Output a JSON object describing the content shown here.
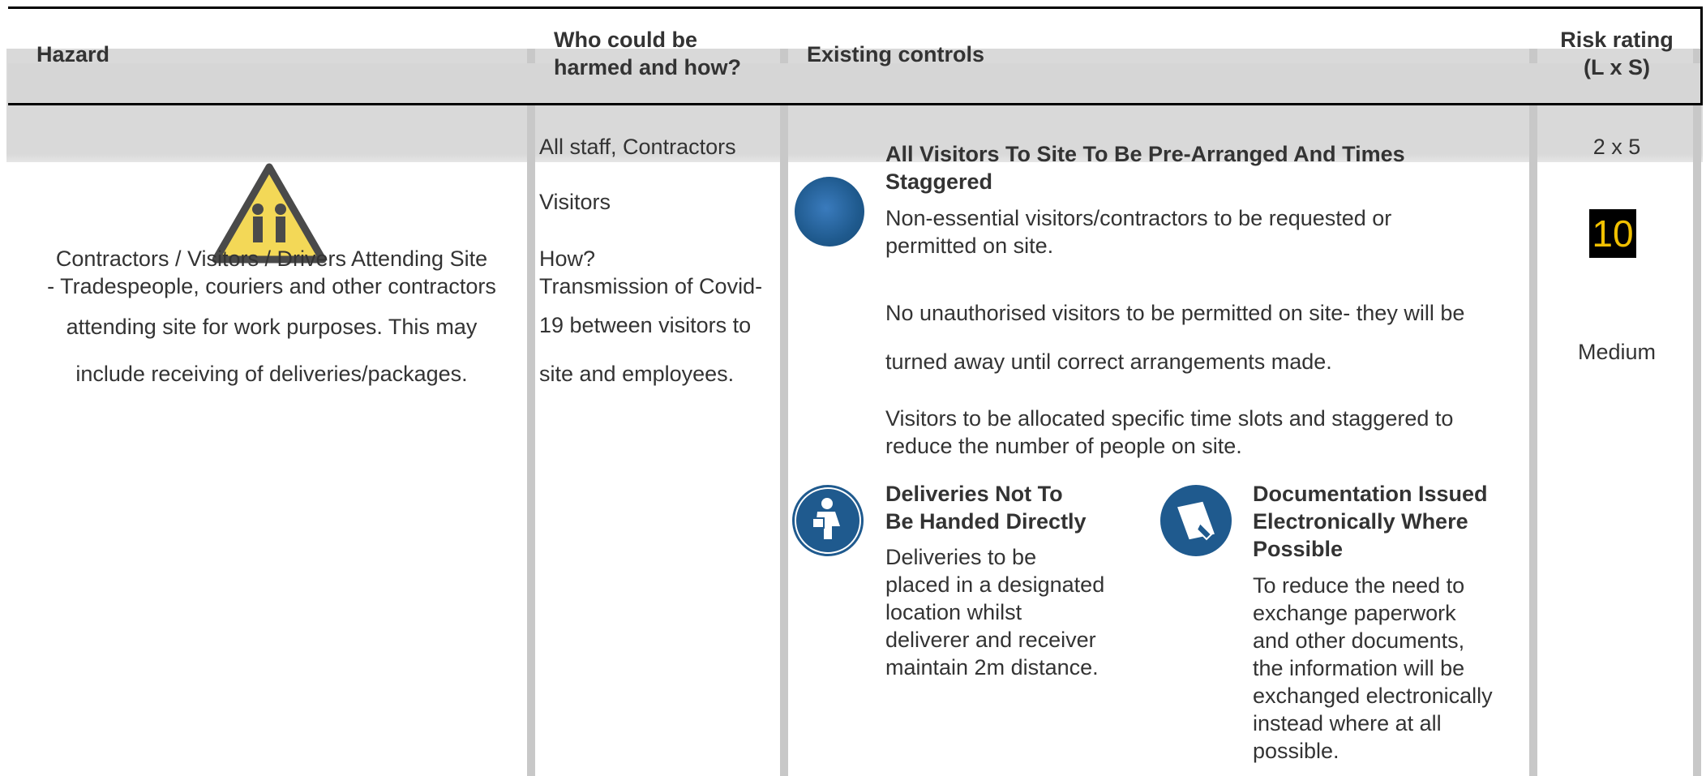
{
  "headers": {
    "hazard": "Hazard",
    "who": [
      "Who could be",
      "harmed and how?"
    ],
    "controls": "Existing controls",
    "risk": [
      "Risk rating",
      "(L x S)"
    ]
  },
  "hazard": {
    "lines": [
      "Contractors / Visitors / Drivers Attending Site",
      "- Tradespeople, couriers and other contractors",
      "attending site for work purposes. This may",
      "include receiving of deliveries/packages."
    ],
    "icon": "warning-triangle-icon"
  },
  "who": {
    "line1": "All staff, Contractors",
    "line2": "Visitors",
    "line3": "How?",
    "line4": "Transmission of Covid-",
    "line5": "19 between visitors to",
    "line6": "site and employees."
  },
  "controls": {
    "prearranged": {
      "icon": "globe-icon",
      "title": [
        "All Visitors To Site To Be Pre-Arranged And Times",
        "Staggered"
      ],
      "body": [
        "Non-essential visitors/contractors to be requested or",
        "permitted on site."
      ]
    },
    "unauthorised": [
      "No unauthorised visitors to be permitted on site- they will be",
      "turned away until correct arrangements made."
    ],
    "staggered": [
      "Visitors to be allocated specific time slots and staggered to",
      "reduce the number of people on site."
    ],
    "deliveries": {
      "icon": "delivery-person-icon",
      "title": [
        "Deliveries Not To",
        "Be Handed Directly"
      ],
      "body": [
        "Deliveries to be",
        "placed in a designated",
        "location whilst",
        "deliverer and receiver",
        "maintain 2m distance."
      ]
    },
    "documentation": {
      "icon": "document-icon",
      "title": [
        "Documentation Issued",
        "Electronically Where",
        "Possible"
      ],
      "body": [
        "To reduce the need to",
        "exchange paperwork",
        "and other documents,",
        "the information will be",
        "exchanged electronically",
        "instead where at all",
        "possible."
      ]
    }
  },
  "risk": {
    "lxs": "2 x 5",
    "score": "10",
    "level": "Medium",
    "score_bg": "#000000",
    "score_color": "#f0c000"
  },
  "colors": {
    "icon_blue": "#1f5a8e",
    "warning_yellow": "#f2d23a"
  }
}
